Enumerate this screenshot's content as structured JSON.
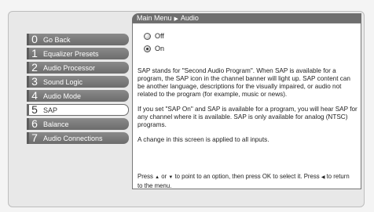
{
  "breadcrumb": {
    "parent": "Main Menu",
    "current": "Audio"
  },
  "menu": [
    {
      "num": "0",
      "label": "Go Back",
      "selected": false
    },
    {
      "num": "1",
      "label": "Equalizer Presets",
      "selected": false
    },
    {
      "num": "2",
      "label": "Audio Processor",
      "selected": false
    },
    {
      "num": "3",
      "label": "Sound Logic",
      "selected": false
    },
    {
      "num": "4",
      "label": "Audio Mode",
      "selected": false
    },
    {
      "num": "5",
      "label": "SAP",
      "selected": true
    },
    {
      "num": "6",
      "label": "Balance",
      "selected": false
    },
    {
      "num": "7",
      "label": "Audio Connections",
      "selected": false
    }
  ],
  "options": [
    {
      "label": "Off",
      "checked": false
    },
    {
      "label": "On",
      "checked": true
    }
  ],
  "description": [
    "SAP stands for \"Second Audio Program\".  When SAP is available for a program, the SAP icon in the channel banner will light up. SAP content can be another language, descriptions for the visually impaired, or audio not related to the program (for example, music or news).",
    "If you set \"SAP On\" and SAP is available for a program, you will hear SAP for any channel where it is available. SAP is only available for analog (NTSC) programs.",
    "A change in this screen is applied to all inputs."
  ],
  "hint": {
    "part1": "Press",
    "up": "▲",
    "or": "or",
    "down": "▼",
    "part2": "to point to an option, then press OK to select it. Press",
    "left": "◀",
    "part3": "to return to the menu."
  }
}
